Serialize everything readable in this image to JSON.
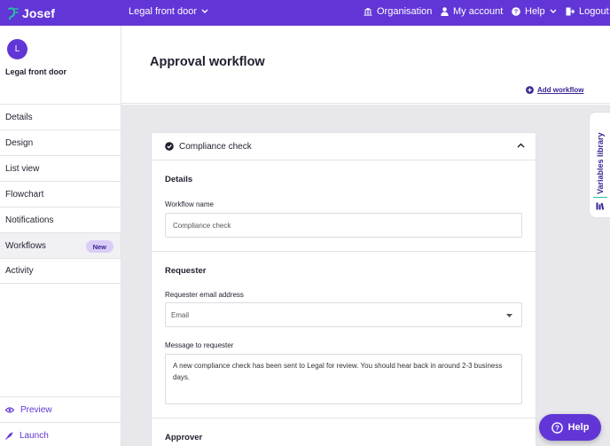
{
  "app": {
    "logo_text": "Josef",
    "brand_color": "#6236d6"
  },
  "topbar": {
    "project_name": "Legal front door",
    "nav": [
      {
        "label": "Organisation",
        "icon": "bank-icon"
      },
      {
        "label": "My account",
        "icon": "user-icon"
      },
      {
        "label": "Help",
        "icon": "help-circle-icon"
      },
      {
        "label": "Logout",
        "icon": "logout-icon"
      }
    ]
  },
  "sidebar": {
    "avatar_letter": "L",
    "project_name": "Legal front door",
    "items": [
      {
        "label": "Details"
      },
      {
        "label": "Design"
      },
      {
        "label": "List view"
      },
      {
        "label": "Flowchart"
      },
      {
        "label": "Notifications"
      },
      {
        "label": "Workflows",
        "badge": "New",
        "active": true
      },
      {
        "label": "Activity"
      }
    ],
    "footer": {
      "preview": "Preview",
      "launch": "Launch"
    }
  },
  "main": {
    "title": "Approval workflow",
    "add_workflow": "Add workflow"
  },
  "card": {
    "title": "Compliance check",
    "details": {
      "section_title": "Details",
      "workflow_name_label": "Workflow name",
      "workflow_name_value": "Compliance check"
    },
    "requester": {
      "section_title": "Requester",
      "email_label": "Requester email address",
      "email_value": "Email",
      "message_label": "Message to requester",
      "message_value": "A new compliance check has been sent to Legal for review. You should hear back in around 2-3 business days."
    },
    "approver": {
      "section_title": "Approver"
    }
  },
  "variables_library": {
    "label": "Variables library"
  },
  "help_button": {
    "label": "Help"
  }
}
